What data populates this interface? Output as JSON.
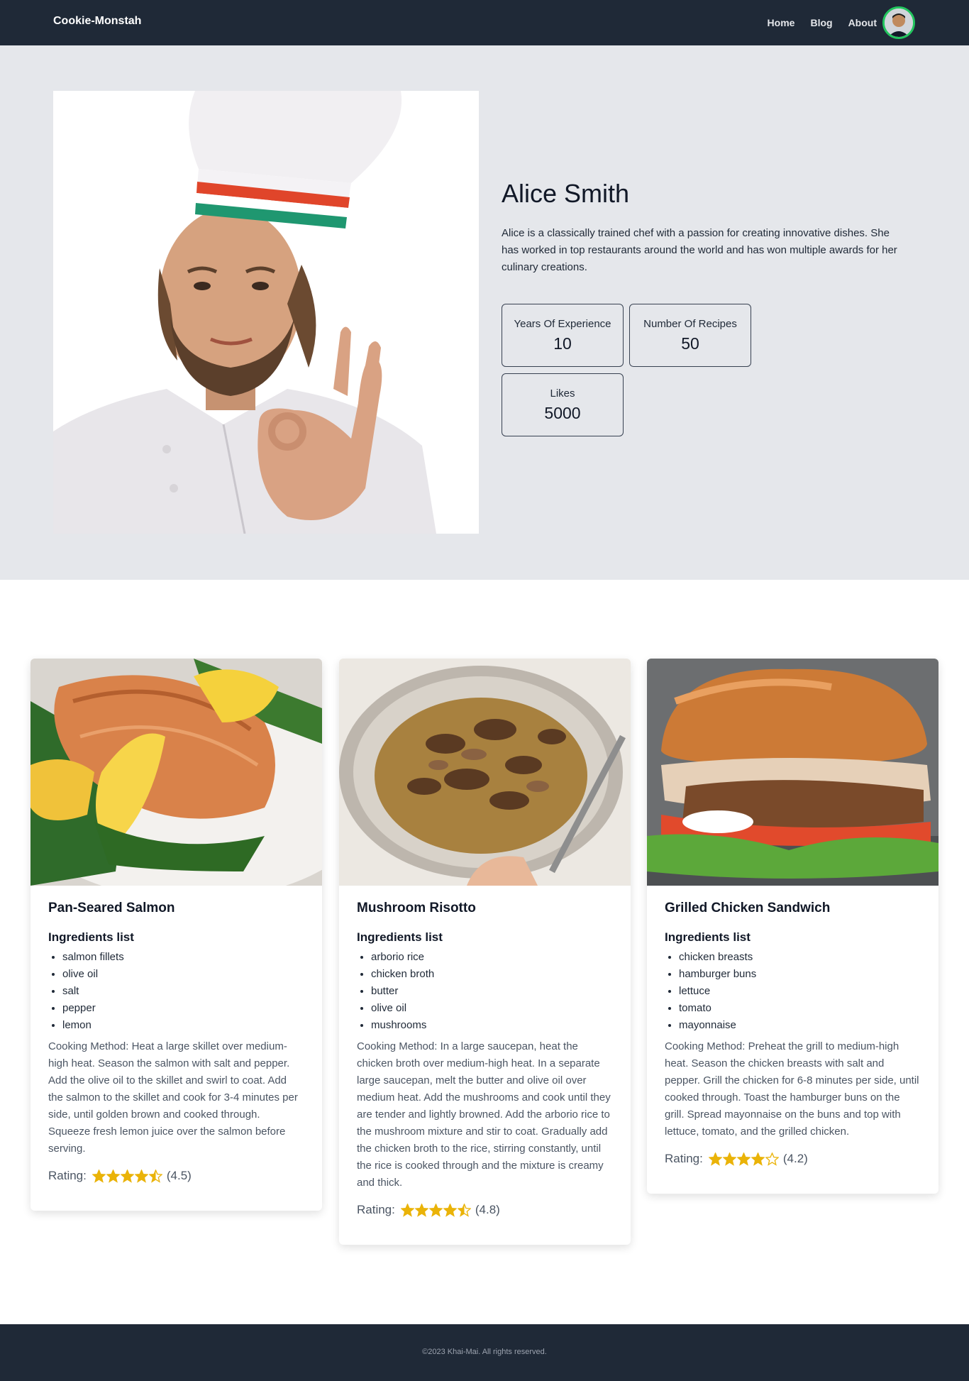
{
  "nav": {
    "brand": "Cookie-Monstah",
    "links": [
      "Home",
      "Blog",
      "About"
    ]
  },
  "chef": {
    "name": "Alice Smith",
    "bio": "Alice is a classically trained chef with a passion for creating innovative dishes. She has worked in top restaurants around the world and has won multiple awards for her culinary creations.",
    "stats": [
      {
        "label": "Years Of Experience",
        "value": "10"
      },
      {
        "label": "Number Of Recipes",
        "value": "50"
      },
      {
        "label": "Likes",
        "value": "5000"
      }
    ]
  },
  "recipes": [
    {
      "title": "Pan-Seared Salmon",
      "ingredients_heading": "Ingredients list",
      "ingredients": [
        "salmon fillets",
        "olive oil",
        "salt",
        "pepper",
        "lemon"
      ],
      "method": "Cooking Method: Heat a large skillet over medium-high heat. Season the salmon with salt and pepper. Add the olive oil to the skillet and swirl to coat. Add the salmon to the skillet and cook for 3-4 minutes per side, until golden brown and cooked through. Squeeze fresh lemon juice over the salmon before serving.",
      "rating_label": "Rating:",
      "rating": 4.5,
      "rating_text": "(4.5)"
    },
    {
      "title": "Mushroom Risotto",
      "ingredients_heading": "Ingredients list",
      "ingredients": [
        "arborio rice",
        "chicken broth",
        "butter",
        "olive oil",
        "mushrooms"
      ],
      "method": "Cooking Method: In a large saucepan, heat the chicken broth over medium-high heat. In a separate large saucepan, melt the butter and olive oil over medium heat. Add the mushrooms and cook until they are tender and lightly browned. Add the arborio rice to the mushroom mixture and stir to coat. Gradually add the chicken broth to the rice, stirring constantly, until the rice is cooked through and the mixture is creamy and thick.",
      "rating_label": "Rating:",
      "rating": 4.8,
      "rating_text": "(4.8)"
    },
    {
      "title": "Grilled Chicken Sandwich",
      "ingredients_heading": "Ingredients list",
      "ingredients": [
        "chicken breasts",
        "hamburger buns",
        "lettuce",
        "tomato",
        "mayonnaise"
      ],
      "method": "Cooking Method: Preheat the grill to medium-high heat. Season the chicken breasts with salt and pepper. Grill the chicken for 6-8 minutes per side, until cooked through. Toast the hamburger buns on the grill. Spread mayonnaise on the buns and top with lettuce, tomato, and the grilled chicken.",
      "rating_label": "Rating:",
      "rating": 4.2,
      "rating_text": "(4.2)"
    }
  ],
  "footer": {
    "copyright": "©2023 Khai-Mai. All rights reserved."
  },
  "colors": {
    "navbar": "#1f2937",
    "hero_bg": "#e5e7eb",
    "star": "#eab308",
    "heart": "#dc2626",
    "avatar_ring": "#22c55e"
  },
  "icons": [
    "star-icon",
    "half-star-icon",
    "empty-star-icon",
    "heart-icon",
    "user-avatar"
  ]
}
